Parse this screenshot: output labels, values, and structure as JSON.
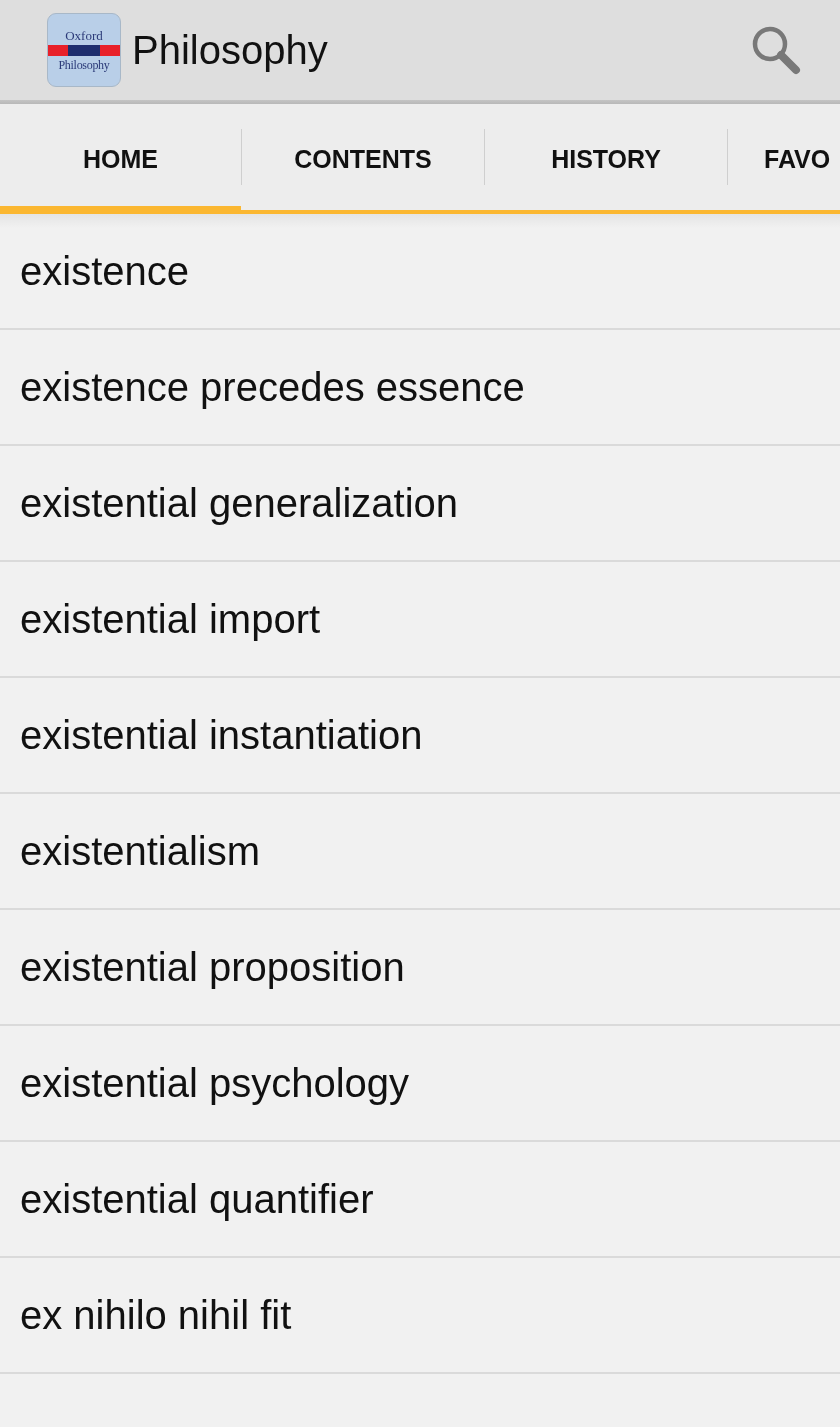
{
  "app_bar": {
    "icon": {
      "top_text": "Oxford",
      "bottom_text": "Philosophy"
    },
    "title": "Philosophy"
  },
  "tabs": [
    {
      "label": "HOME",
      "selected": true
    },
    {
      "label": "CONTENTS",
      "selected": false
    },
    {
      "label": "HISTORY",
      "selected": false
    },
    {
      "label": "FAVO",
      "selected": false
    }
  ],
  "entries": [
    "existence",
    "existence precedes essence",
    "existential generalization",
    "existential import",
    "existential instantiation",
    "existentialism",
    "existential proposition",
    "existential psychology",
    "existential quantifier",
    "ex nihilo nihil fit"
  ]
}
